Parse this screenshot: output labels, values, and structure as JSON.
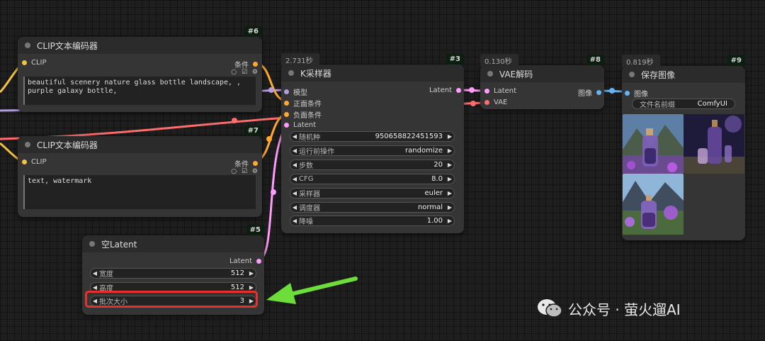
{
  "colors": {
    "clip": "#f5c142",
    "conditioning": "#ffa931",
    "latent": "#ff9cf9",
    "vae": "#ff6e6e",
    "image": "#64b5f6",
    "model": "#b39ddb",
    "highlight": "#e5322b",
    "arrow": "#6ddd3a"
  },
  "nodes": {
    "clip_pos": {
      "id": "#6",
      "title": "CLIP文本编码器",
      "input_label": "CLIP",
      "output_label": "条件",
      "icons": "○ ☑ ⚙",
      "text": "beautiful scenery nature glass bottle landscape, ,\npurple galaxy bottle,"
    },
    "clip_neg": {
      "id": "#7",
      "title": "CLIP文本编码器",
      "input_label": "CLIP",
      "output_label": "条件",
      "icons": "○ ☑ ⚙",
      "text": "text, watermark"
    },
    "empty_latent": {
      "id": "#5",
      "title": "空Latent",
      "output_label": "Latent",
      "widgets": [
        {
          "label": "宽度",
          "value": "512"
        },
        {
          "label": "高度",
          "value": "512"
        },
        {
          "label": "批次大小",
          "value": "3"
        }
      ]
    },
    "ksampler": {
      "id": "#3",
      "title": "K采样器",
      "time": "2.731秒",
      "inputs": [
        "模型",
        "正面条件",
        "负面条件",
        "Latent"
      ],
      "output_label": "Latent",
      "widgets": [
        {
          "label": "随机种",
          "value": "950658822451593"
        },
        {
          "label": "运行前操作",
          "value": "randomize"
        },
        {
          "label": "步数",
          "value": "20"
        },
        {
          "label": "CFG",
          "value": "8.0"
        },
        {
          "label": "采样器",
          "value": "euler"
        },
        {
          "label": "调度器",
          "value": "normal"
        },
        {
          "label": "降噪",
          "value": "1.00"
        }
      ]
    },
    "vae_decode": {
      "id": "#8",
      "title": "VAE解码",
      "time": "0.130秒",
      "inputs": [
        "Latent",
        "VAE"
      ],
      "output_label": "图像"
    },
    "save_image": {
      "id": "#9",
      "title": "保存图像",
      "time": "0.819秒",
      "input_label": "图像",
      "prefix_label": "文件名前缀",
      "prefix_value": "ComfyUI"
    }
  },
  "watermark": {
    "text": "公众号 · 萤火遛AI"
  },
  "icons": {
    "arrow_left": "◀",
    "arrow_right": "▶",
    "annotation_arrow": "green-arrow-icon",
    "watermark_logo": "wechat-icon"
  }
}
